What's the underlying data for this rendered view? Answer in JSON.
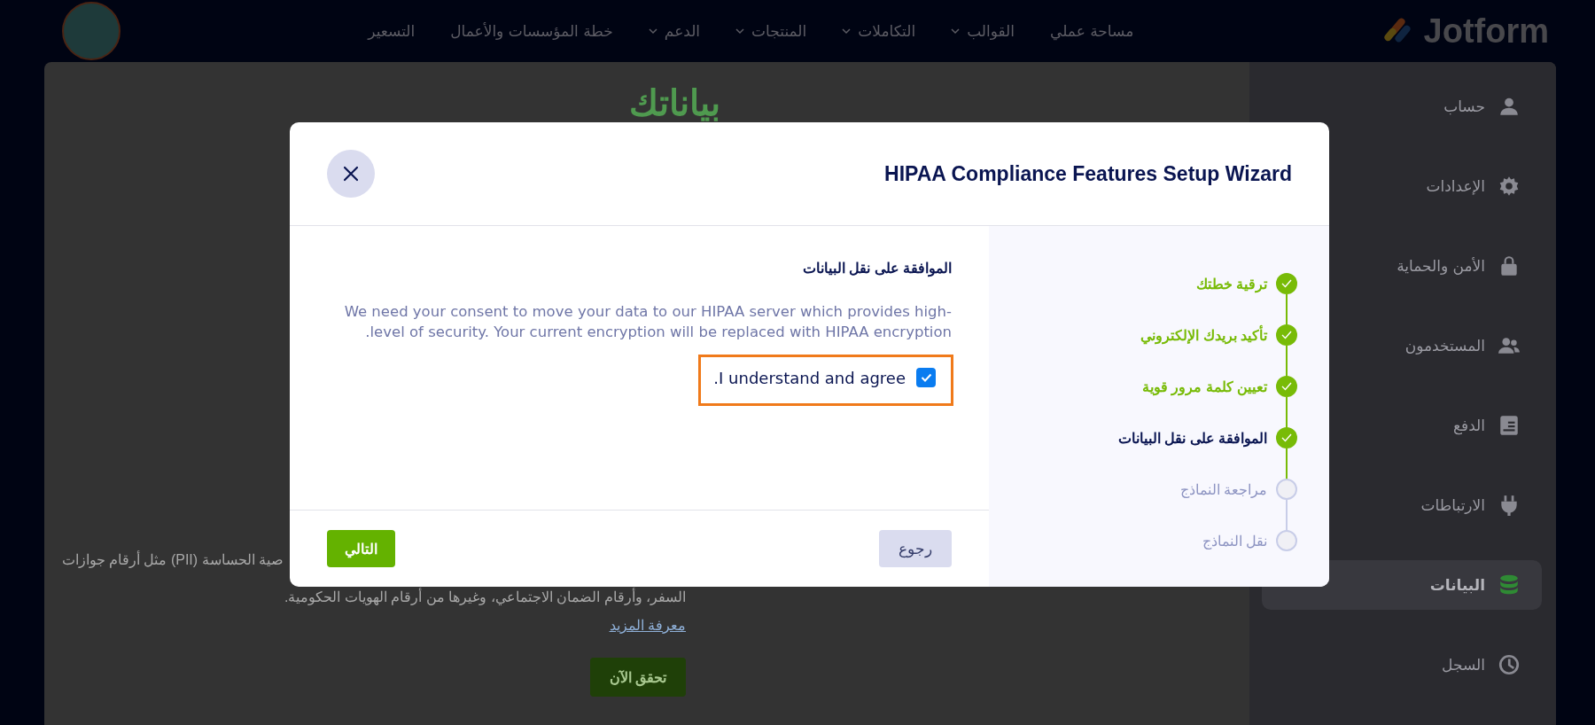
{
  "navbar": {
    "logo": "Jotform",
    "items": [
      {
        "label": "مساحة عملي",
        "dropdown": false
      },
      {
        "label": "القوالب",
        "dropdown": true
      },
      {
        "label": "التكاملات",
        "dropdown": true
      },
      {
        "label": "المنتجات",
        "dropdown": true
      },
      {
        "label": "الدعم",
        "dropdown": true
      },
      {
        "label": "خطة المؤسسات والأعمال",
        "dropdown": false
      },
      {
        "label": "التسعير",
        "dropdown": false
      }
    ]
  },
  "sidebar": {
    "items": [
      {
        "label": "حساب",
        "selected": false
      },
      {
        "label": "الإعدادات",
        "selected": false
      },
      {
        "label": "الأمن والحماية",
        "selected": false
      },
      {
        "label": "المستخدمون",
        "selected": false
      },
      {
        "label": "الدفع",
        "selected": false
      },
      {
        "label": "الارتباطات",
        "selected": false
      },
      {
        "label": "البيانات",
        "selected": true
      },
      {
        "label": "السجل",
        "selected": false
      }
    ]
  },
  "page": {
    "title": "بياناتك",
    "paragraph_line_1": "صية الحساسة (PII) مثل أرقام جوازات",
    "paragraph_line_2": "السفر، وأرقام الضمان الاجتماعي، وغيرها من أرقام الهويات الحكومية.",
    "link": "معرفة المزيد",
    "button": "تحقق الآن"
  },
  "dialog": {
    "title": "HIPAA Compliance Features Setup Wizard",
    "steps": [
      {
        "label": "ترقية خطتك",
        "completed": true,
        "selected": false
      },
      {
        "label": "تأكيد بريدك الإلكتروني",
        "completed": true,
        "selected": false
      },
      {
        "label": "تعيين كلمة مرور قوية",
        "completed": true,
        "selected": false
      },
      {
        "label": "الموافقة على نقل البيانات",
        "completed": true,
        "selected": true
      },
      {
        "label": "مراجعة النماذج",
        "completed": false,
        "selected": false
      },
      {
        "label": "نقل النماذج",
        "completed": false,
        "selected": false
      }
    ],
    "section_title": "الموافقة على نقل البيانات",
    "description": "We need your consent to move your data to our HIPAA server which provides high-level of security. Your current encryption will be replaced with HIPAA encryption.",
    "agree": {
      "label": "I understand and agree.",
      "checked": true,
      "highlighted": true
    },
    "back_button": "رجوع",
    "next_button": "التالي"
  }
}
